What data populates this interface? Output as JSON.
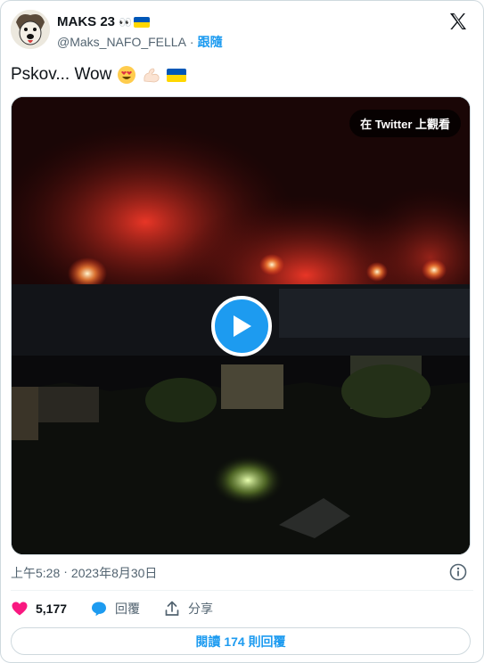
{
  "author": {
    "display_name": "MAKS 23",
    "eyes_emoji": "👀",
    "handle": "@Maks_NAFO_FELLA",
    "separator": "·",
    "follow_label": "跟隨"
  },
  "tweet": {
    "text": "Pskov... Wow",
    "emojis": [
      "heart-eyes-emoji",
      "flexed-biceps-emoji",
      "ukraine-flag-emoji"
    ]
  },
  "media": {
    "watch_label": "在 Twitter 上觀看",
    "play_icon": "play-icon"
  },
  "timestamp": {
    "time": "上午5:28",
    "separator": "·",
    "date": "2023年8月30日"
  },
  "actions": {
    "like_count": "5,177",
    "reply_label": "回覆",
    "share_label": "分享"
  },
  "read_replies": {
    "prefix": "閱讀",
    "count": "174",
    "suffix": "則回覆"
  },
  "colors": {
    "accent": "#1d9bf0",
    "heart": "#f91880",
    "text_secondary": "#536471",
    "flag_blue": "#0057b7",
    "flag_yellow": "#ffd700"
  }
}
